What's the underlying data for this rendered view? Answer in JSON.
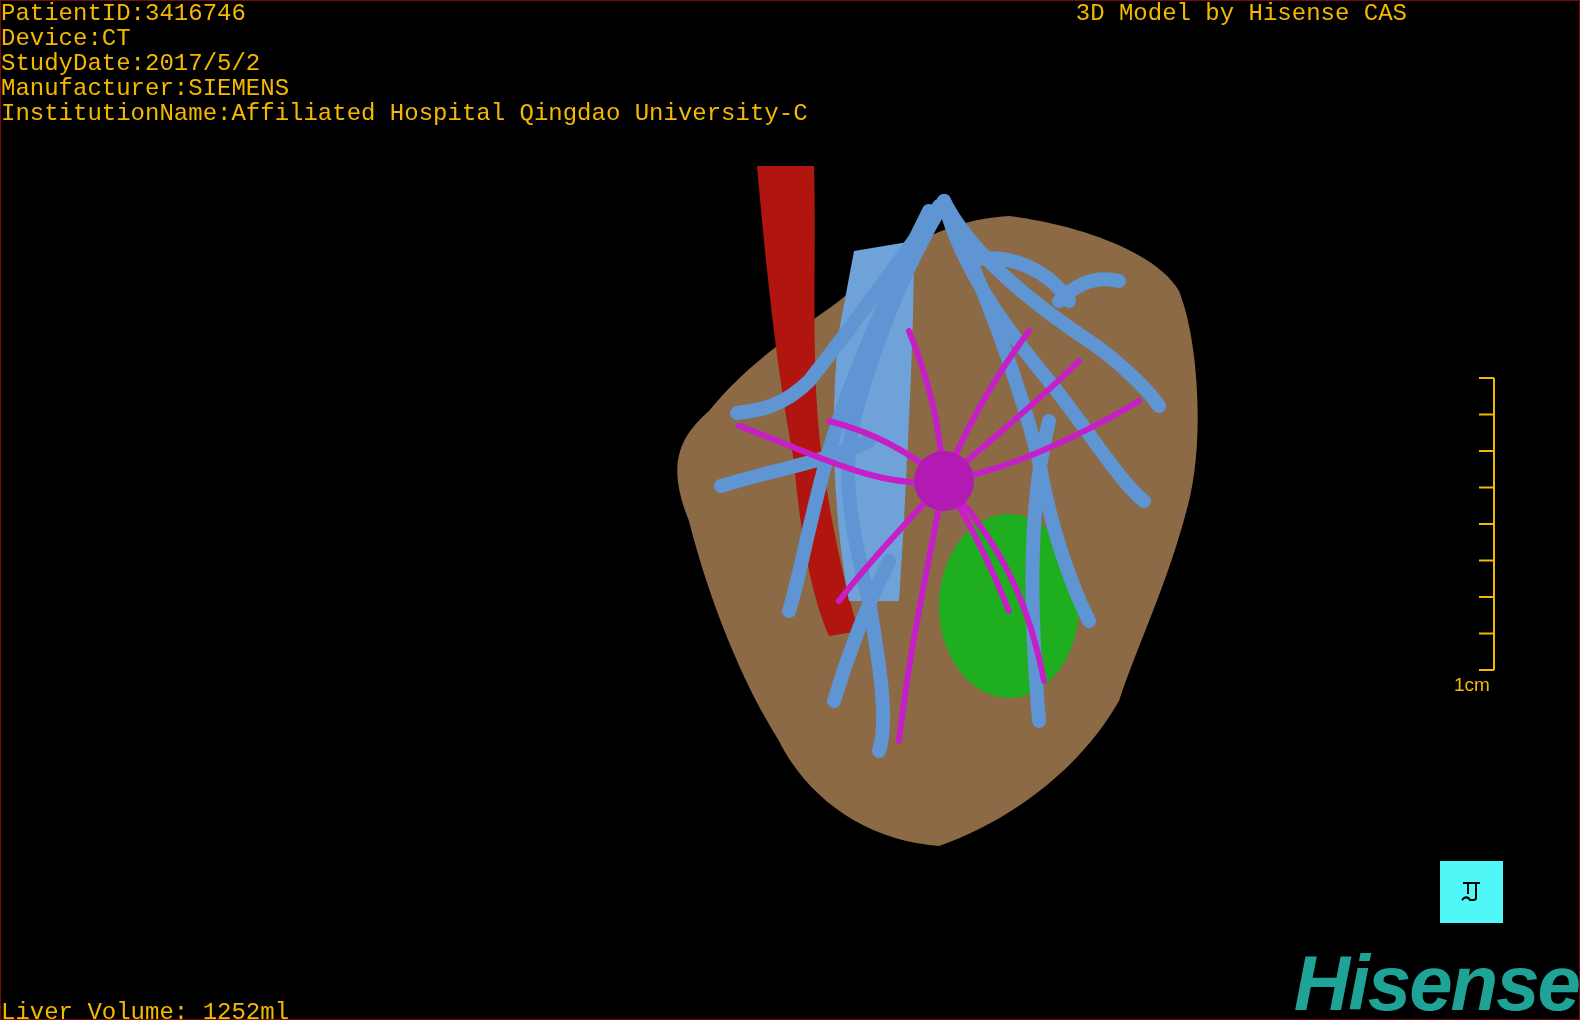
{
  "patient_info": [
    "PatientID:3416746",
    "Device:CT",
    "StudyDate:2017/5/2",
    "Manufacturer:SIEMENS",
    "InstitutionName:Affiliated Hospital Qingdao University-C"
  ],
  "credit": "3D Model by Hisense CAS",
  "scale_bar": {
    "label": "1cm"
  },
  "liver_volume": "Liver Volume: 1252ml",
  "logo": "Hisense"
}
